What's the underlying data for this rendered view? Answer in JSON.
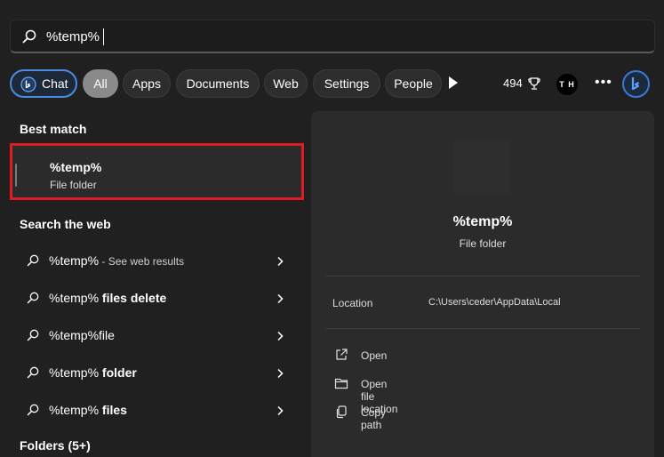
{
  "search": {
    "value": "%temp%"
  },
  "filters": {
    "chat": "Chat",
    "all": "All",
    "apps": "Apps",
    "documents": "Documents",
    "web": "Web",
    "settings": "Settings",
    "people": "People"
  },
  "rewards": {
    "points": "494"
  },
  "profile": {
    "initials": "T H"
  },
  "best_match": {
    "heading": "Best match",
    "name": "%temp%",
    "type": "File folder"
  },
  "web_search": {
    "heading": "Search the web",
    "items": [
      {
        "query": "%temp%",
        "bold": "",
        "hint": " - See web results"
      },
      {
        "query": "%temp%",
        "bold": " files delete",
        "hint": ""
      },
      {
        "query": "%temp%file",
        "bold": "",
        "hint": ""
      },
      {
        "query": "%temp%",
        "bold": " folder",
        "hint": ""
      },
      {
        "query": "%temp%",
        "bold": " files",
        "hint": ""
      }
    ]
  },
  "folders": {
    "heading": "Folders (5+)"
  },
  "preview": {
    "name": "%temp%",
    "type": "File folder",
    "location_label": "Location",
    "location_value": "C:\\Users\\ceder\\AppData\\Local",
    "actions": {
      "open": "Open",
      "open_location": "Open file location",
      "copy_path": "Copy path"
    }
  },
  "colors": {
    "background": "#202020",
    "panel": "#2b2b2b",
    "highlight": "#e01b24",
    "accent": "#4c8ce0"
  }
}
